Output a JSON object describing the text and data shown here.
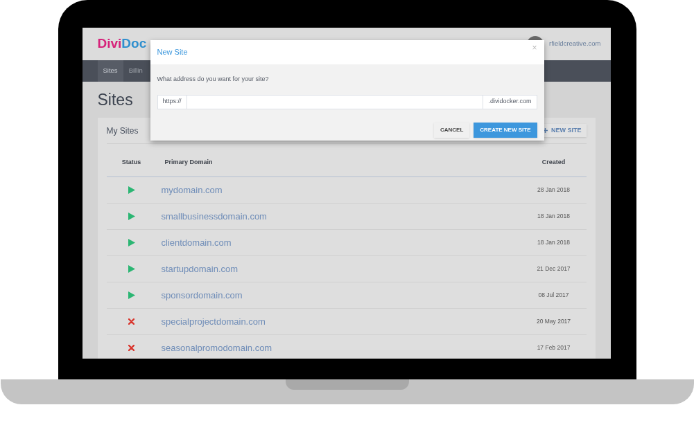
{
  "header": {
    "logo": {
      "part_1": "Divi",
      "part_2": "Doc"
    },
    "account": "rfieldcreative.com"
  },
  "nav": {
    "tabs": [
      {
        "label": "Sites",
        "selected": true
      },
      {
        "label": "Billin",
        "selected": false
      }
    ]
  },
  "page_title": "Sites",
  "card": {
    "title": "My Sites",
    "new_button": "NEW SITE"
  },
  "table": {
    "columns": [
      "Status",
      "Primary Domain",
      "Created"
    ],
    "rows": [
      {
        "kind": "running",
        "domain": "mydomain.com",
        "created": "28 Jan 2018"
      },
      {
        "kind": "running",
        "domain": "smallbusinessdomain.com",
        "created": "18 Jan 2018"
      },
      {
        "kind": "running",
        "domain": "clientdomain.com",
        "created": "18 Jan 2018"
      },
      {
        "kind": "running",
        "domain": "startupdomain.com",
        "created": "21 Dec 2017"
      },
      {
        "kind": "running",
        "domain": "sponsordomain.com",
        "created": "08 Jul 2017"
      },
      {
        "kind": "stopped",
        "domain": "specialprojectdomain.com",
        "created": "20 May 2017"
      },
      {
        "kind": "stopped",
        "domain": "seasonalpromodomain.com",
        "created": "17 Feb 2017"
      }
    ]
  },
  "dialog": {
    "title": "New Site",
    "close": "×",
    "question": "What address do you want for your site?",
    "prefix": "https://",
    "suffix": ".dividocker.com",
    "buttons": {
      "cancel": "CANCEL",
      "create": "CREATE NEW SITE"
    }
  }
}
